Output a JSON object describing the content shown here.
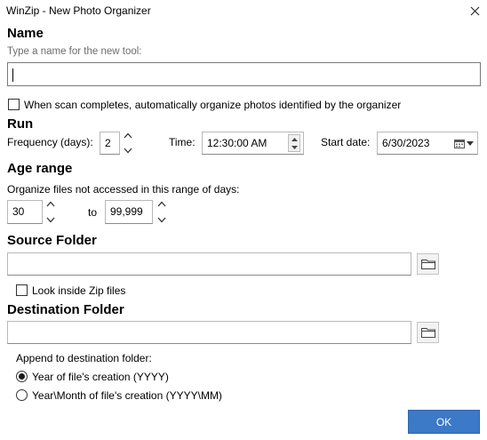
{
  "window": {
    "title": "WinZip - New Photo Organizer"
  },
  "name_section": {
    "heading": "Name",
    "hint": "Type a name for the new tool:",
    "value": ""
  },
  "auto_organize": {
    "label": "When scan completes, automatically organize photos identified by the organizer",
    "checked": false
  },
  "run": {
    "heading": "Run",
    "frequency_label": "Frequency (days):",
    "frequency_value": "2",
    "time_label": "Time:",
    "time_value": "12:30:00 AM",
    "start_date_label": "Start date:",
    "start_date_value": "6/30/2023"
  },
  "age_range": {
    "heading": "Age range",
    "hint": "Organize files not accessed in this range of days:",
    "from_value": "30",
    "to_label": "to",
    "to_value": "99,999"
  },
  "source_folder": {
    "heading": "Source Folder",
    "value": "",
    "look_inside_zip_label": "Look inside Zip files",
    "look_inside_zip_checked": false
  },
  "destination_folder": {
    "heading": "Destination Folder",
    "value": "",
    "append_label": "Append to destination folder:",
    "options": [
      {
        "label": "Year of file's creation (YYYY)",
        "selected": true
      },
      {
        "label": "Year\\Month of file's creation (YYYY\\MM)",
        "selected": false
      }
    ]
  },
  "ok_button": {
    "label": "OK"
  }
}
